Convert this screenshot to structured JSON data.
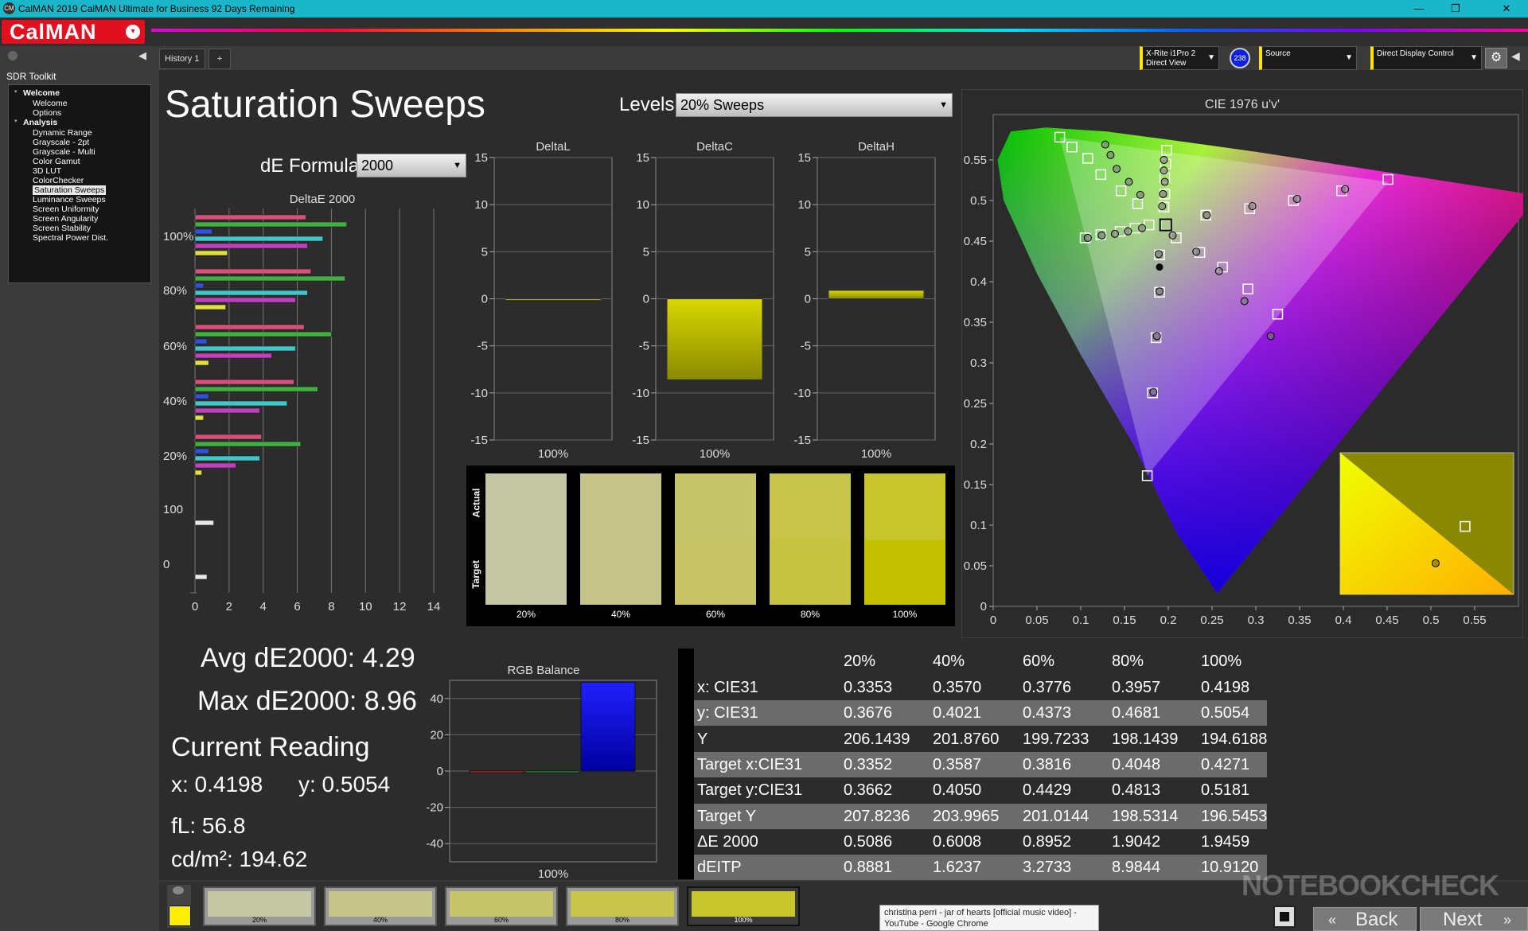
{
  "window": {
    "title": "CalMAN 2019 CalMAN Ultimate for Business 92 Days Remaining",
    "app_icon": "CM",
    "minimize": "—",
    "restore": "❐",
    "close": "✕"
  },
  "logo": {
    "text": "CalMAN",
    "menu_icon": "▾"
  },
  "left_panel": {
    "toolkit_title": "SDR Toolkit",
    "nav": [
      {
        "label": "Welcome",
        "type": "header"
      },
      {
        "label": "Welcome",
        "type": "item"
      },
      {
        "label": "Options",
        "type": "item"
      },
      {
        "label": "Analysis",
        "type": "header"
      },
      {
        "label": "Dynamic Range",
        "type": "item"
      },
      {
        "label": "Grayscale - 2pt",
        "type": "item"
      },
      {
        "label": "Grayscale - Multi",
        "type": "item"
      },
      {
        "label": "Color Gamut",
        "type": "item"
      },
      {
        "label": "3D LUT",
        "type": "item"
      },
      {
        "label": "ColorChecker",
        "type": "item"
      },
      {
        "label": "Saturation Sweeps",
        "type": "selected"
      },
      {
        "label": "Luminance Sweeps",
        "type": "item"
      },
      {
        "label": "Screen Uniformity",
        "type": "item"
      },
      {
        "label": "Screen Angularity",
        "type": "item"
      },
      {
        "label": "Screen Stability",
        "type": "item"
      },
      {
        "label": "Spectral Power Dist.",
        "type": "item"
      }
    ]
  },
  "tabs": {
    "history": "History 1",
    "add": "+"
  },
  "devices": {
    "meter_line1": "X-Rite i1Pro 2",
    "meter_line2": "Direct View",
    "meter_badge": "238",
    "source": "Source",
    "display": "Direct Display Control"
  },
  "main": {
    "page_title": "Saturation Sweeps",
    "levels_label": "Levels:",
    "levels_value": "20% Sweeps",
    "de_formula_label": "dE Formula:",
    "de_formula_value": "2000"
  },
  "deltae_chart": {
    "title": "DeltaE 2000",
    "y_labels": [
      "100%",
      "80%",
      "60%",
      "40%",
      "20%",
      "100",
      "0"
    ],
    "x_ticks": [
      0,
      2,
      4,
      6,
      8,
      10,
      12,
      14
    ],
    "colors": [
      "#d8507a",
      "#40b040",
      "#3050e0",
      "#40c8c8",
      "#c040c0",
      "#e0e040"
    ],
    "groups": [
      [
        6.5,
        8.9,
        1.0,
        7.5,
        6.6,
        1.9
      ],
      [
        6.8,
        8.8,
        0.5,
        6.6,
        5.9,
        1.8
      ],
      [
        6.4,
        8.0,
        0.7,
        5.9,
        4.5,
        0.8
      ],
      [
        5.8,
        7.2,
        0.8,
        5.4,
        3.8,
        0.5
      ],
      [
        3.9,
        6.2,
        0.8,
        3.8,
        2.4,
        0.4
      ],
      [
        1.1
      ],
      [
        0.7
      ]
    ]
  },
  "delta_charts": [
    {
      "title": "DeltaL",
      "value": 0.0,
      "x_label": "100%"
    },
    {
      "title": "DeltaC",
      "value": -8.6,
      "x_label": "100%"
    },
    {
      "title": "DeltaH",
      "value": 0.9,
      "x_label": "100%"
    }
  ],
  "delta_axis": {
    "ticks": [
      15,
      10,
      5,
      0,
      -5,
      -10,
      -15
    ]
  },
  "swatches": {
    "actual_label": "Actual",
    "target_label": "Target",
    "items": [
      {
        "label": "20%",
        "actual": "#c5c6a4",
        "target": "#c5c6a4"
      },
      {
        "label": "40%",
        "actual": "#c5c58a",
        "target": "#c5c58a"
      },
      {
        "label": "60%",
        "actual": "#c7c56a",
        "target": "#c6c466"
      },
      {
        "label": "80%",
        "actual": "#c7c54a",
        "target": "#c6c341"
      },
      {
        "label": "100%",
        "actual": "#c8c52a",
        "target": "#c3c000"
      }
    ]
  },
  "cie": {
    "title": "CIE 1976 u'v'",
    "x_ticks": [
      "0",
      "0.05",
      "0.1",
      "0.15",
      "0.2",
      "0.25",
      "0.3",
      "0.35",
      "0.4",
      "0.45",
      "0.5",
      "0.55"
    ],
    "y_ticks": [
      "0",
      "0.05",
      "0.1",
      "0.15",
      "0.2",
      "0.25",
      "0.3",
      "0.35",
      "0.4",
      "0.45",
      "0.5",
      "0.55"
    ],
    "targets": [
      [
        0.076,
        0.578
      ],
      [
        0.09,
        0.566
      ],
      [
        0.108,
        0.552
      ],
      [
        0.123,
        0.532
      ],
      [
        0.146,
        0.512
      ],
      [
        0.165,
        0.496
      ],
      [
        0.198,
        0.562
      ],
      [
        0.197,
        0.545
      ],
      [
        0.196,
        0.528
      ],
      [
        0.196,
        0.508
      ],
      [
        0.195,
        0.492
      ],
      [
        0.197,
        0.47
      ],
      [
        0.105,
        0.454
      ],
      [
        0.123,
        0.458
      ],
      [
        0.145,
        0.462
      ],
      [
        0.162,
        0.466
      ],
      [
        0.178,
        0.47
      ],
      [
        0.243,
        0.482
      ],
      [
        0.293,
        0.49
      ],
      [
        0.343,
        0.5
      ],
      [
        0.398,
        0.512
      ],
      [
        0.451,
        0.526
      ],
      [
        0.209,
        0.454
      ],
      [
        0.236,
        0.436
      ],
      [
        0.262,
        0.418
      ],
      [
        0.291,
        0.391
      ],
      [
        0.325,
        0.36
      ],
      [
        0.19,
        0.433
      ],
      [
        0.19,
        0.387
      ],
      [
        0.186,
        0.331
      ],
      [
        0.182,
        0.263
      ],
      [
        0.176,
        0.161
      ]
    ],
    "measured": [
      [
        0.128,
        0.569
      ],
      [
        0.134,
        0.556
      ],
      [
        0.141,
        0.539
      ],
      [
        0.155,
        0.523
      ],
      [
        0.168,
        0.507
      ],
      [
        0.195,
        0.55
      ],
      [
        0.195,
        0.537
      ],
      [
        0.196,
        0.523
      ],
      [
        0.194,
        0.508
      ],
      [
        0.193,
        0.493
      ],
      [
        0.108,
        0.454
      ],
      [
        0.124,
        0.457
      ],
      [
        0.139,
        0.459
      ],
      [
        0.154,
        0.462
      ],
      [
        0.17,
        0.466
      ],
      [
        0.244,
        0.482
      ],
      [
        0.296,
        0.493
      ],
      [
        0.347,
        0.502
      ],
      [
        0.402,
        0.514
      ],
      [
        0.205,
        0.457
      ],
      [
        0.232,
        0.437
      ],
      [
        0.258,
        0.413
      ],
      [
        0.287,
        0.376
      ],
      [
        0.317,
        0.333
      ],
      [
        0.189,
        0.434
      ],
      [
        0.19,
        0.388
      ],
      [
        0.187,
        0.333
      ],
      [
        0.183,
        0.264
      ]
    ],
    "white_point": [
      0.19,
      0.418
    ]
  },
  "zoom_inset": {
    "target": [
      0.72,
      0.52
    ],
    "measured": [
      0.55,
      0.78
    ]
  },
  "stats": {
    "avg": "Avg dE2000: 4.29",
    "max": "Max dE2000: 8.96",
    "current_title": "Current Reading",
    "x": "x: 0.4198",
    "y": "y: 0.5054",
    "fl": "fL: 56.8",
    "cdm2": "cd/m²: 194.62"
  },
  "rgb_balance": {
    "title": "RGB Balance",
    "y_ticks": [
      40,
      20,
      0,
      -20,
      -40
    ],
    "x_label": "100%",
    "values": [
      -0.5,
      -0.8,
      49
    ],
    "colors": [
      "#ff3030",
      "#30c030",
      "#1010ff"
    ]
  },
  "table": {
    "headers": [
      "20%",
      "40%",
      "60%",
      "80%",
      "100%"
    ],
    "rows": [
      {
        "label": "x: CIE31",
        "values": [
          "0.3353",
          "0.3570",
          "0.3776",
          "0.3957",
          "0.4198"
        ]
      },
      {
        "label": "y: CIE31",
        "values": [
          "0.3676",
          "0.4021",
          "0.4373",
          "0.4681",
          "0.5054"
        ]
      },
      {
        "label": "Y",
        "values": [
          "206.1439",
          "201.8760",
          "199.7233",
          "198.1439",
          "194.6188"
        ]
      },
      {
        "label": "Target x:CIE31",
        "values": [
          "0.3352",
          "0.3587",
          "0.3816",
          "0.4048",
          "0.4271"
        ]
      },
      {
        "label": "Target y:CIE31",
        "values": [
          "0.3662",
          "0.4050",
          "0.4429",
          "0.4813",
          "0.5181"
        ]
      },
      {
        "label": "Target Y",
        "values": [
          "207.8236",
          "203.9965",
          "201.0144",
          "198.5314",
          "196.5453"
        ]
      },
      {
        "label": "ΔE 2000",
        "values": [
          "0.5086",
          "0.6008",
          "0.8952",
          "1.9042",
          "1.9459"
        ]
      },
      {
        "label": "dEITP",
        "values": [
          "0.8881",
          "1.6237",
          "3.2733",
          "8.9844",
          "10.9120"
        ]
      }
    ]
  },
  "bottom": {
    "current_color": "#ffee00",
    "swatches": [
      {
        "label": "20%",
        "color": "#c5c6a4"
      },
      {
        "label": "40%",
        "color": "#c5c58a"
      },
      {
        "label": "60%",
        "color": "#c7c56a"
      },
      {
        "label": "80%",
        "color": "#c7c54a"
      },
      {
        "label": "100%",
        "color": "#c8c52a"
      }
    ],
    "back": "Back",
    "next": "Next",
    "tooltip_line1": "christina perri - jar of hearts [official music video] -",
    "tooltip_line2": "YouTube - Google Chrome",
    "watermark": "NOTEBOOKCHECK"
  }
}
